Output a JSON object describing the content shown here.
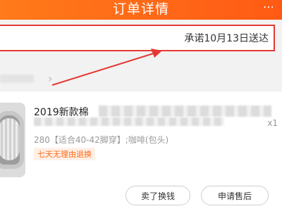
{
  "header": {
    "title": "订单详情",
    "more_icon": "ellipsis-icon"
  },
  "delivery": {
    "promise_text": "承诺10月13日送达"
  },
  "shop": {
    "chevron": "›"
  },
  "item": {
    "title_prefix": "2019新款棉",
    "quantity": "x1",
    "sku_text": "280【适合40-42脚穿】;咖啡(包头)",
    "return_tag": "七天无理由退换"
  },
  "actions": {
    "sell_label": "卖了换钱",
    "aftersale_label": "申请售后"
  },
  "colors": {
    "header": "#ff5a14",
    "accent": "#ff6a13",
    "annotation": "#e53935"
  }
}
